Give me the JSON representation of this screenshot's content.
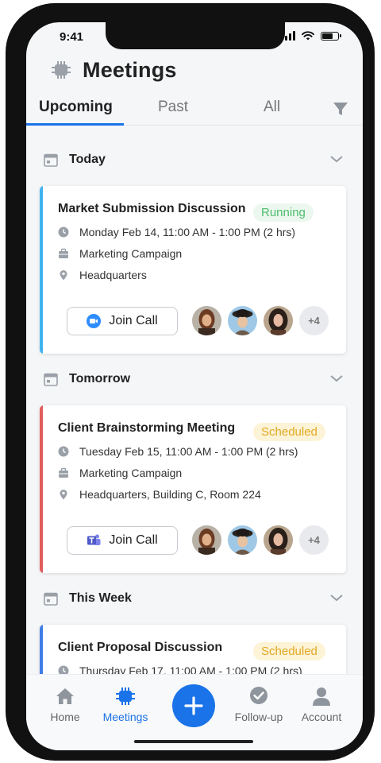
{
  "status_bar": {
    "time": "9:41"
  },
  "header": {
    "title": "Meetings",
    "icon": "chip-icon"
  },
  "tabs": [
    {
      "label": "Upcoming",
      "active": true
    },
    {
      "label": "Past",
      "active": false
    },
    {
      "label": "All",
      "active": false
    }
  ],
  "sections": [
    {
      "label": "Today",
      "meeting": {
        "title": "Market Submission Discussion",
        "status": "Running",
        "accent": "#3fb3f0",
        "time": "Monday Feb 14, 11:00 AM - 1:00 PM (2 hrs)",
        "campaign": "Marketing Campaign",
        "location": "Headquarters",
        "join_label": "Join Call",
        "call_app": "zoom-icon",
        "extra_attendees": "+4"
      }
    },
    {
      "label": "Tomorrow",
      "meeting": {
        "title": "Client Brainstorming Meeting",
        "status": "Scheduled",
        "accent": "#e25d5d",
        "time": "Tuesday Feb 15, 11:00 AM - 1:00 PM (2 hrs)",
        "campaign": "Marketing Campaign",
        "location": "Headquarters, Building C, Room 224",
        "join_label": "Join Call",
        "call_app": "teams-icon",
        "extra_attendees": "+4"
      }
    },
    {
      "label": "This Week",
      "meeting": {
        "title": "Client Proposal Discussion",
        "status": "Scheduled",
        "accent": "#3f7de8",
        "time": "Thursday Feb 17, 11:00 AM - 1:00 PM (2 hrs)"
      }
    }
  ],
  "bottom_nav": [
    {
      "label": "Home",
      "icon": "home-icon"
    },
    {
      "label": "Meetings",
      "icon": "chip-icon",
      "active": true
    },
    {
      "label": "Follow-up",
      "icon": "check-circle-icon"
    },
    {
      "label": "Account",
      "icon": "person-icon"
    }
  ],
  "colors": {
    "primary": "#1a73e8",
    "running": "#4cbd6b",
    "scheduled": "#e1a922"
  }
}
